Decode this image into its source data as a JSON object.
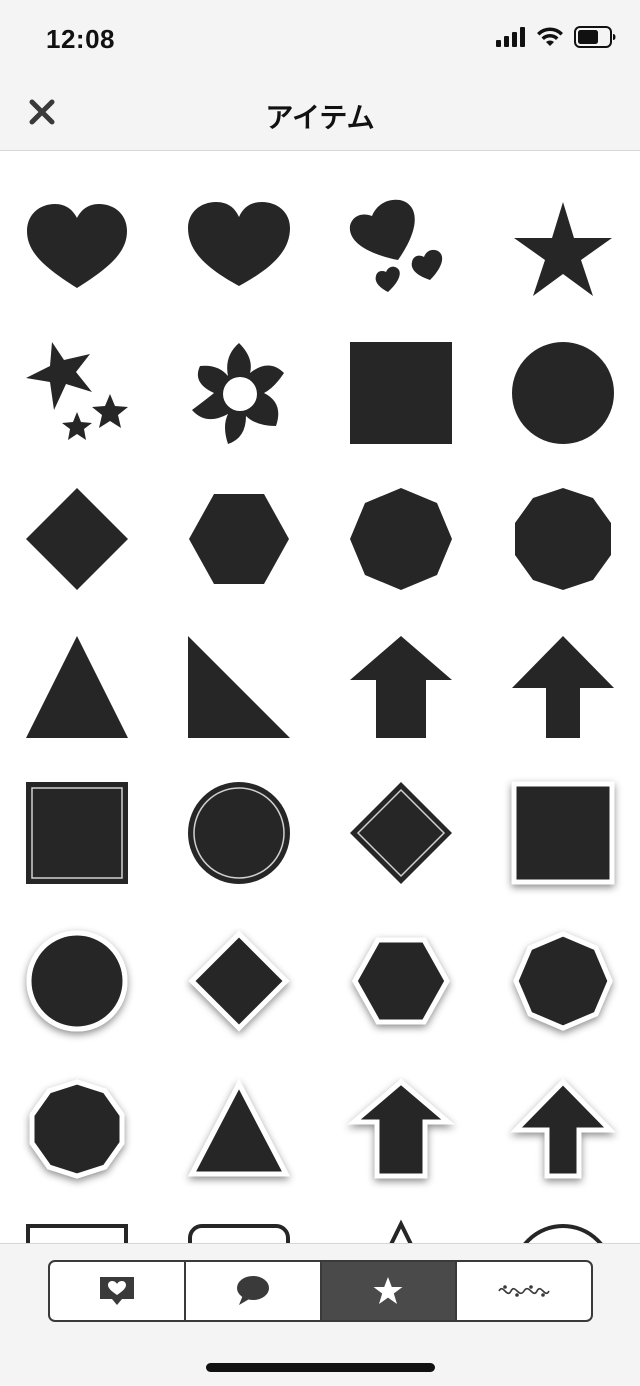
{
  "status_bar": {
    "time": "12:08"
  },
  "nav": {
    "title": "アイテム"
  },
  "grid": {
    "rows": [
      [
        "heart-icon",
        "heart-wide-icon",
        "hearts-cluster-icon",
        "star-icon"
      ],
      [
        "stars-cluster-icon",
        "flower-icon",
        "square-icon",
        "circle-icon"
      ],
      [
        "diamond-icon",
        "hexagon-icon",
        "octagon-icon",
        "decagon-icon"
      ],
      [
        "triangle-icon",
        "right-triangle-icon",
        "arrow-up-icon",
        "arrow-up-thin-icon"
      ],
      [
        "square-inner-border-icon",
        "circle-inner-border-icon",
        "diamond-inner-border-icon",
        "square-shadow-icon"
      ],
      [
        "circle-shadow-icon",
        "diamond-shadow-icon",
        "hexagon-shadow-icon",
        "octagon-shadow-icon"
      ],
      [
        "decagon-shadow-icon",
        "triangle-shadow-icon",
        "arrow-up-shadow-icon",
        "arrow-up-thin-shadow-icon"
      ],
      [
        "square-outline-icon",
        "rounded-square-outline-icon",
        "triangle-outline-icon",
        "circle-outline-icon"
      ]
    ]
  },
  "tabs": {
    "items": [
      {
        "name": "tab-heart-stamp",
        "icon": "heart-stamp-icon",
        "active": false
      },
      {
        "name": "tab-speech-bubble",
        "icon": "speech-bubble-icon",
        "active": false
      },
      {
        "name": "tab-shapes",
        "icon": "star-icon",
        "active": true
      },
      {
        "name": "tab-decorations",
        "icon": "ornament-line-icon",
        "active": false
      }
    ]
  },
  "colors": {
    "shape_fill": "#262626",
    "bar_background": "#f4f4f4",
    "active_tab": "#4a4a4a"
  }
}
